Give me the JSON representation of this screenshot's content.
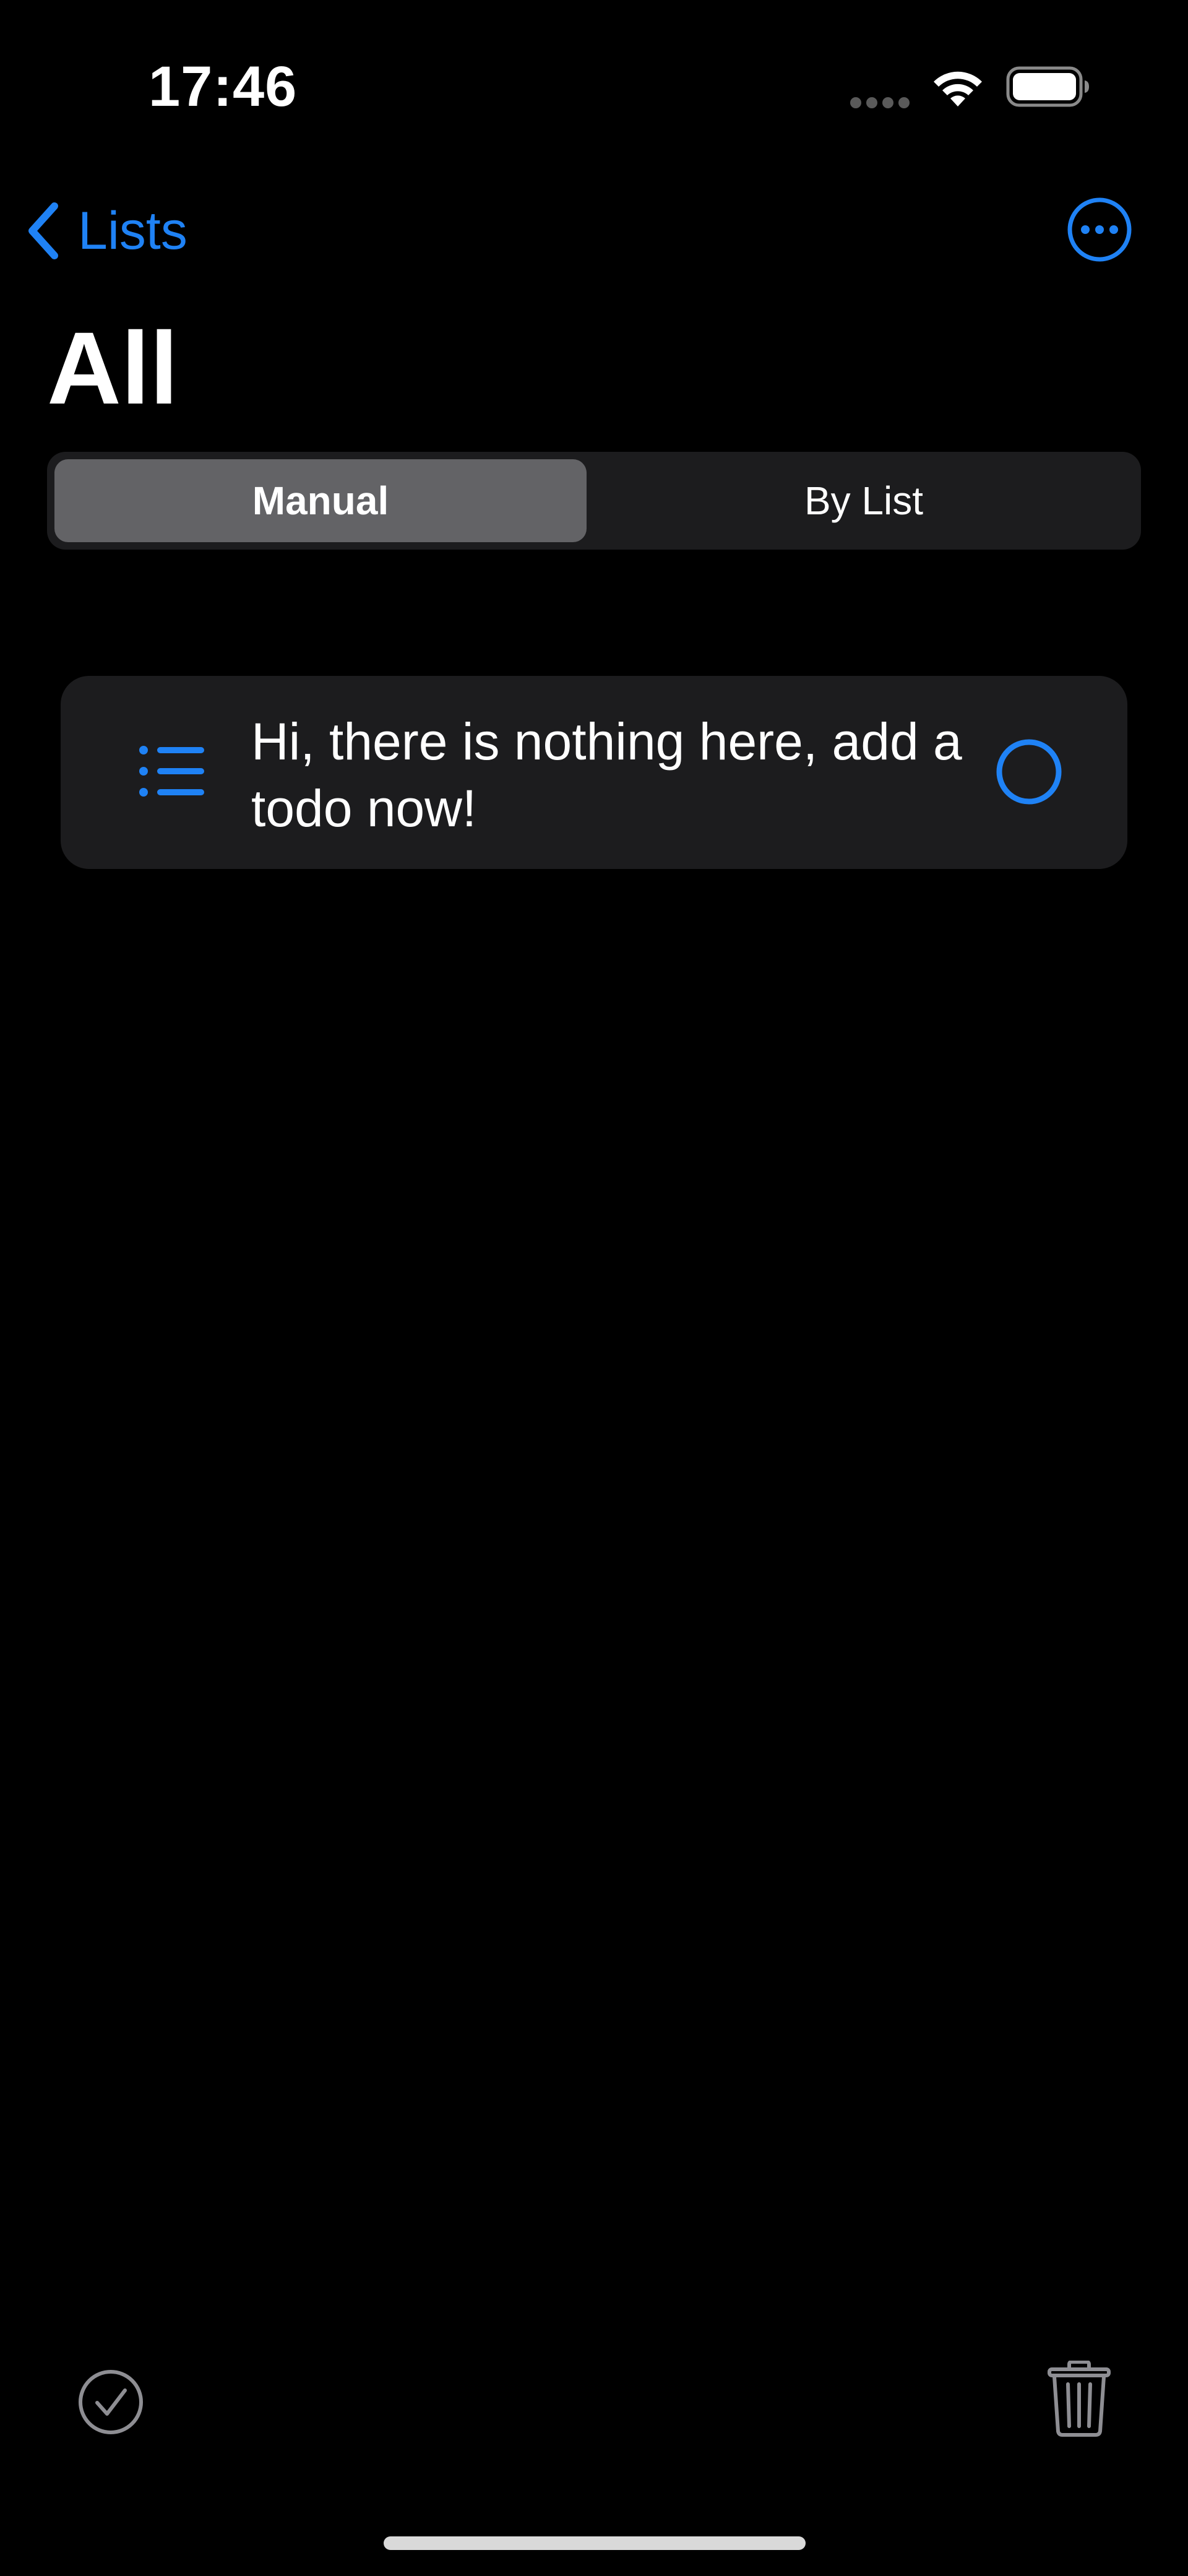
{
  "status_bar": {
    "time": "17:46",
    "icons": [
      "cellular-signal-icon",
      "wifi-icon",
      "battery-icon"
    ]
  },
  "nav": {
    "back_label": "Lists",
    "back_icon": "chevron-left-icon",
    "more_icon": "ellipsis-circle-icon"
  },
  "page": {
    "title": "All"
  },
  "segmented_control": {
    "options": [
      "Manual",
      "By List"
    ],
    "selected": "Manual"
  },
  "todo": {
    "icon": "list-bullet-icon",
    "text": "Hi, there is nothing here, add a todo now!",
    "completed": false
  },
  "toolbar": {
    "left_icon": "checkmark-circle-icon",
    "right_icon": "trash-icon"
  },
  "colors": {
    "accent": "#1f82f5",
    "background": "#000000",
    "card": "#1c1c1e",
    "segment_selected": "#636366",
    "toolbar_icon": "#8e8e93"
  }
}
